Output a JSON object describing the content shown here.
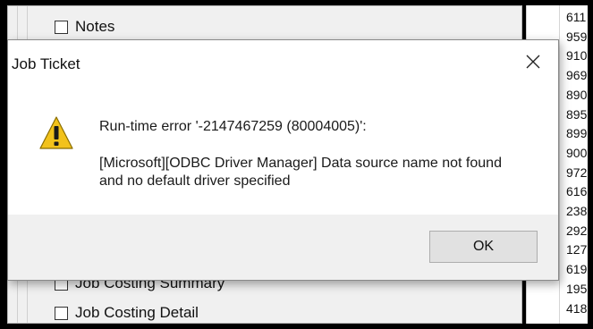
{
  "background_app": {
    "checkboxes": [
      {
        "label": "Notes",
        "checked": false
      },
      {
        "label": "Job Costing Summary",
        "checked": false
      },
      {
        "label": "Job Costing Detail",
        "checked": false
      }
    ],
    "right_column_numbers": [
      "611",
      "959",
      "910",
      "969",
      "890",
      "895",
      "899",
      "900",
      "972",
      "616",
      "238",
      "292",
      "127",
      "619",
      "195",
      "418"
    ]
  },
  "dialog": {
    "title": "Job Ticket",
    "icon": "warning-icon",
    "error_heading": "Run-time error '-2147467259 (80004005)':",
    "error_message": "[Microsoft][ODBC Driver Manager] Data source name not found and no default driver specified",
    "ok_label": "OK",
    "close_glyph": "✕"
  },
  "colors": {
    "warning_fill": "#f2c21b",
    "warning_mark": "#1a1a1a",
    "footer_bg": "#f0f0f0"
  }
}
